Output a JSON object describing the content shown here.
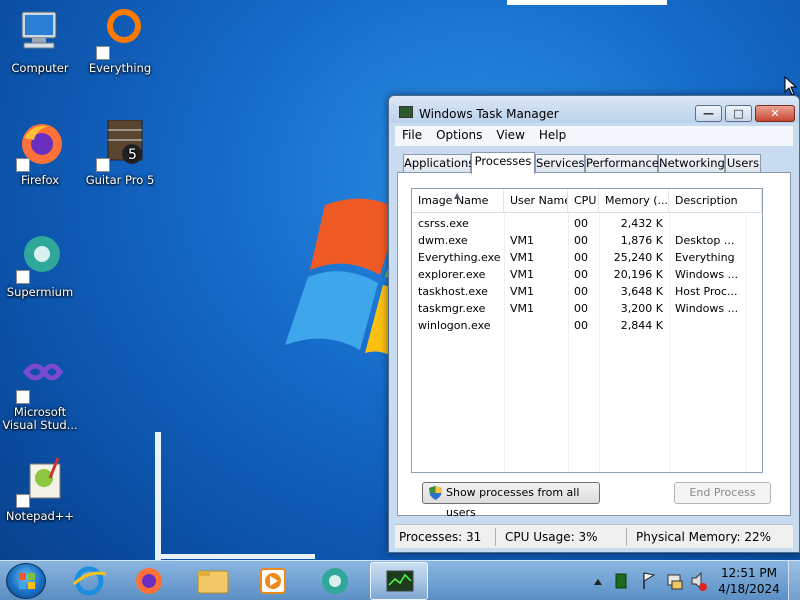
{
  "desktop": {
    "icons": [
      {
        "label": "Computer"
      },
      {
        "label": "Everything"
      },
      {
        "label": "Firefox"
      },
      {
        "label": "Guitar Pro 5"
      },
      {
        "label": "Supermium"
      },
      {
        "label": "Microsoft Visual Stud..."
      },
      {
        "label": "Notepad++"
      }
    ]
  },
  "task_manager": {
    "title": "Windows Task Manager",
    "menu": [
      "File",
      "Options",
      "View",
      "Help"
    ],
    "tabs": [
      "Applications",
      "Processes",
      "Services",
      "Performance",
      "Networking",
      "Users"
    ],
    "active_tab": "Processes",
    "columns": [
      "Image Name",
      "User Name",
      "CPU",
      "Memory (...",
      "Description"
    ],
    "rows": [
      {
        "image": "csrss.exe",
        "user": "",
        "cpu": "00",
        "memory": "2,432 K",
        "description": ""
      },
      {
        "image": "dwm.exe",
        "user": "VM1",
        "cpu": "00",
        "memory": "1,876 K",
        "description": "Desktop ..."
      },
      {
        "image": "Everything.exe",
        "user": "VM1",
        "cpu": "00",
        "memory": "25,240 K",
        "description": "Everything"
      },
      {
        "image": "explorer.exe",
        "user": "VM1",
        "cpu": "00",
        "memory": "20,196 K",
        "description": "Windows ..."
      },
      {
        "image": "taskhost.exe",
        "user": "VM1",
        "cpu": "00",
        "memory": "3,648 K",
        "description": "Host Proc..."
      },
      {
        "image": "taskmgr.exe",
        "user": "VM1",
        "cpu": "00",
        "memory": "3,200 K",
        "description": "Windows ..."
      },
      {
        "image": "winlogon.exe",
        "user": "",
        "cpu": "00",
        "memory": "2,844 K",
        "description": ""
      }
    ],
    "show_all_button": "Show processes from all users",
    "end_process_button": "End Process",
    "status": {
      "processes": "Processes: 31",
      "cpu_usage": "CPU Usage: 3%",
      "physical_memory": "Physical Memory: 22%"
    },
    "window_buttons": {
      "minimize": "—",
      "maximize": "□",
      "close": "✕"
    }
  },
  "taskbar": {
    "items": [
      "start-orb",
      "internet-explorer-icon",
      "firefox-icon",
      "file-explorer-icon",
      "media-player-icon",
      "supermium-icon",
      "task-manager-icon"
    ],
    "active_item": "task-manager-icon",
    "clock_time": "12:51 PM",
    "clock_date": "4/18/2024",
    "tray_icons": [
      "show-hidden-icons-arrow",
      "app-tray-icon",
      "action-center-flag-icon",
      "network-icon",
      "volume-muted-icon"
    ]
  },
  "colors": {
    "desktop_blue": "#1469c7",
    "window_frame": "#c9dbef",
    "close_red": "#c8452f"
  }
}
